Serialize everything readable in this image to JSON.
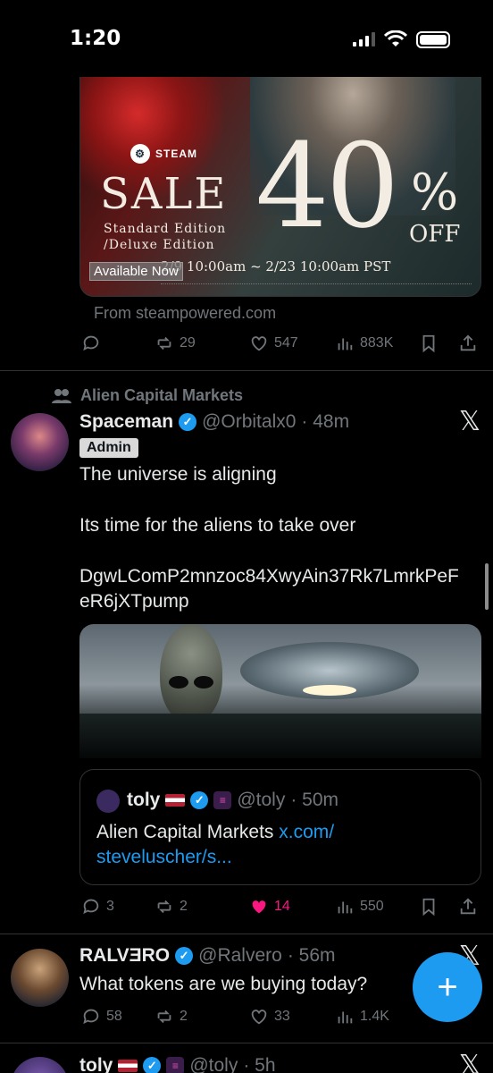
{
  "status_bar": {
    "time": "1:20"
  },
  "steam_post": {
    "brand": "STEAM",
    "sale": "SALE",
    "discount": "40",
    "percent": "%",
    "off": "OFF",
    "edition_line1": "Standard Edition",
    "edition_line2": "/Deluxe Edition",
    "dates": "2/9 10:00am ~ 2/23 10:00am PST",
    "badge": "Available Now",
    "source": "From steampowered.com",
    "stats": {
      "reposts": "29",
      "likes": "547",
      "views": "883K"
    }
  },
  "tweet_main": {
    "community": "Alien Capital Markets",
    "name": "Spaceman",
    "handle": "@Orbitalx0",
    "time": "· 48m",
    "role_badge": "Admin",
    "text_line1": "The universe is aligning",
    "text_line2": "Its time for the aliens to take over",
    "text_line3": "DgwLComP2mnzoc84XwyAin37Rk7LmrkPeF",
    "text_line4": "eR6jXTpump",
    "quote": {
      "name": "toly",
      "handle": "@toly",
      "time": "· 50m",
      "text": "Alien Capital Markets ",
      "link_line1": "x.com/",
      "link_line2": "steveluscher/s..."
    },
    "stats": {
      "replies": "3",
      "reposts": "2",
      "likes": "14",
      "views": "550"
    }
  },
  "tweet_ralvero": {
    "name": "RALVƎRO",
    "handle": "@Ralvero",
    "time": "· 56m",
    "text": "What tokens are we buying today?",
    "stats": {
      "replies": "58",
      "reposts": "2",
      "likes": "33",
      "views": "1.4K"
    }
  },
  "tweet_next": {
    "name": "toly",
    "handle": "@toly",
    "time": "· 5h"
  },
  "fab": {
    "label": "+"
  },
  "colors": {
    "accent": "#1d9bf0",
    "like_active": "#f91880",
    "muted": "#71767b",
    "background": "#000000"
  },
  "icons": [
    "reply-icon",
    "repost-icon",
    "like-icon",
    "views-icon",
    "bookmark-icon",
    "share-icon",
    "x-logo-icon",
    "community-icon",
    "verified-icon"
  ]
}
